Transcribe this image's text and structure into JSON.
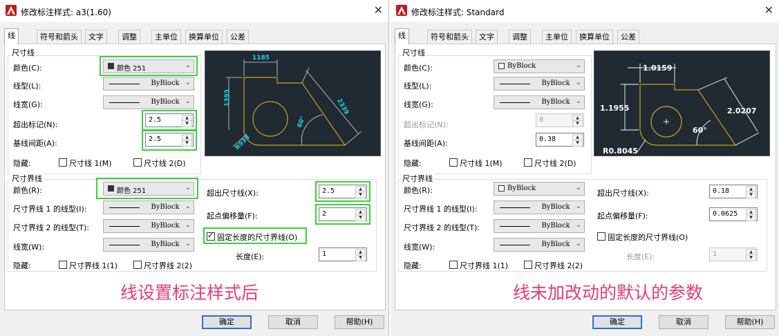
{
  "left": {
    "title": "修改标注样式: a3(1.60)",
    "tabs": [
      "线",
      "符号和箭头",
      "文字",
      "调整",
      "主单位",
      "换算单位",
      "公差"
    ],
    "dim_line": {
      "group": "尺寸线",
      "color_label": "颜色(C):",
      "color_value": "颜色 251",
      "linetype_label": "线型(L):",
      "linetype_value": "ByBlock",
      "lineweight_label": "线宽(G):",
      "lineweight_value": "ByBlock",
      "ext_ticks_label": "超出标记(N):",
      "ext_ticks_value": "2.5",
      "baseline_label": "基线间距(A):",
      "baseline_value": "2.5",
      "suppress_label": "隐藏:",
      "suppress_1": "尺寸线 1(M)",
      "suppress_2": "尺寸线 2(D)"
    },
    "ext_line": {
      "group": "尺寸界线",
      "color_label": "颜色(R):",
      "color_value": "颜色 251",
      "lt1_label": "尺寸界线 1 的线型(I):",
      "lt1_value": "ByBlock",
      "lt2_label": "尺寸界线 2 的线型(T):",
      "lt2_value": "ByBlock",
      "lw_label": "线宽(W):",
      "lw_value": "ByBlock",
      "suppress_label": "隐藏:",
      "suppress_1": "尺寸界线 1(1)",
      "suppress_2": "尺寸界线 2(2)",
      "beyond_label": "超出尺寸线(X):",
      "beyond_value": "2.5",
      "offset_label": "起点偏移量(F):",
      "offset_value": "2",
      "fixed_label": "固定长度的尺寸界线(O)",
      "length_label": "长度(E):",
      "length_value": "1"
    },
    "preview": {
      "top": "1185",
      "left": "1395",
      "right": "2339",
      "radius": "R939",
      "angle": "60°"
    },
    "caption": "线设置标注样式后",
    "buttons": {
      "ok": "确定",
      "cancel": "取消",
      "help": "帮助(H)"
    }
  },
  "right": {
    "title": "修改标注样式: Standard",
    "tabs": [
      "线",
      "符号和箭头",
      "文字",
      "调整",
      "主单位",
      "换算单位",
      "公差"
    ],
    "dim_line": {
      "group": "尺寸线",
      "color_label": "颜色(C):",
      "color_value": "ByBlock",
      "linetype_label": "线型(L):",
      "linetype_value": "ByBlock",
      "lineweight_label": "线宽(G):",
      "lineweight_value": "ByBlock",
      "ext_ticks_label": "超出标记(N):",
      "ext_ticks_value": "0",
      "baseline_label": "基线间距(A):",
      "baseline_value": "0.38",
      "suppress_label": "隐藏:",
      "suppress_1": "尺寸线 1(M)",
      "suppress_2": "尺寸线 2(D)"
    },
    "ext_line": {
      "group": "尺寸界线",
      "color_label": "颜色(R):",
      "color_value": "ByBlock",
      "lt1_label": "尺寸界线 1 的线型(I):",
      "lt1_value": "ByBlock",
      "lt2_label": "尺寸界线 2 的线型(T):",
      "lt2_value": "ByBlock",
      "lw_label": "线宽(W):",
      "lw_value": "ByBlock",
      "suppress_label": "隐藏:",
      "suppress_1": "尺寸界线 1(1)",
      "suppress_2": "尺寸界线 2(2)",
      "beyond_label": "超出尺寸线(X):",
      "beyond_value": "0.18",
      "offset_label": "起点偏移量(F):",
      "offset_value": "0.0625",
      "fixed_label": "固定长度的尺寸界线(O)",
      "length_label": "长度(E):",
      "length_value": "1"
    },
    "preview": {
      "top": "1.0159",
      "left": "1.1955",
      "right": "2.0207",
      "radius": "R0.8045",
      "angle": "60°"
    },
    "caption": "线未加改动的默认的参数",
    "buttons": {
      "ok": "确定",
      "cancel": "取消",
      "help": "帮助(H)"
    }
  },
  "colors": {
    "highlight": "#3ad13a",
    "caption": "#e8397a",
    "preview_bg": "#1f2a33",
    "cad_yellow": "#d4a017",
    "cad_cyan": "#17d4e8"
  }
}
